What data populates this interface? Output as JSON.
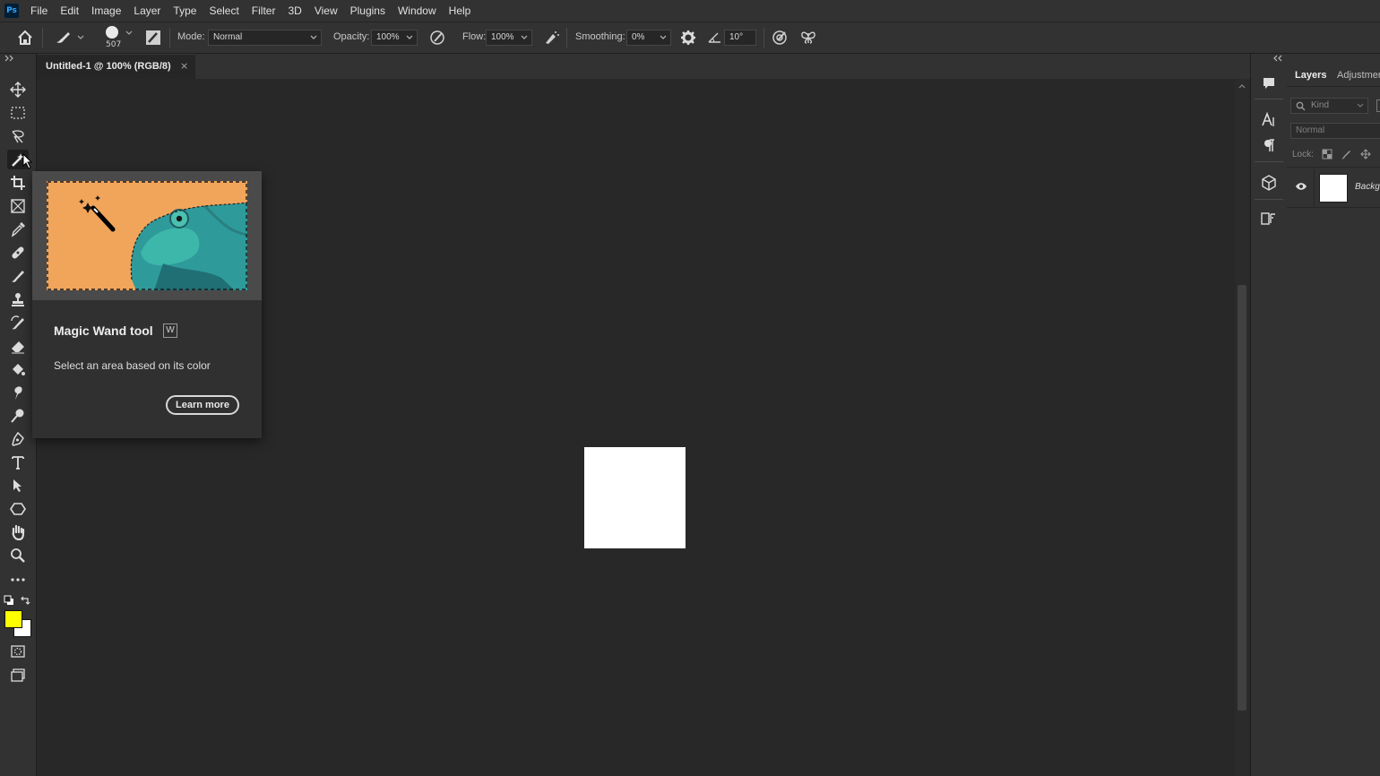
{
  "app": {
    "logo": "Ps"
  },
  "menu": [
    "File",
    "Edit",
    "Image",
    "Layer",
    "Type",
    "Select",
    "Filter",
    "3D",
    "View",
    "Plugins",
    "Window",
    "Help"
  ],
  "options": {
    "brush_size": "507",
    "mode_label": "Mode:",
    "mode_value": "Normal",
    "opacity_label": "Opacity:",
    "opacity_value": "100%",
    "flow_label": "Flow:",
    "flow_value": "100%",
    "smoothing_label": "Smoothing:",
    "smoothing_value": "0%",
    "angle_value": "10°"
  },
  "document": {
    "tab_title": "Untitled-1 @ 100% (RGB/8)",
    "close_glyph": "×"
  },
  "colors": {
    "foreground": "#ffff00",
    "background": "#ffffff",
    "accent": "#31a8ff"
  },
  "tooltip": {
    "tool_name": "Magic Wand tool",
    "shortcut": "W",
    "description": "Select an area based on its color",
    "learn_more": "Learn more"
  },
  "layers_panel": {
    "tabs": [
      "Layers",
      "Adjustmen"
    ],
    "filter_placeholder": "Kind",
    "blend_mode": "Normal",
    "lock_label": "Lock:",
    "layer_name": "Backg"
  }
}
